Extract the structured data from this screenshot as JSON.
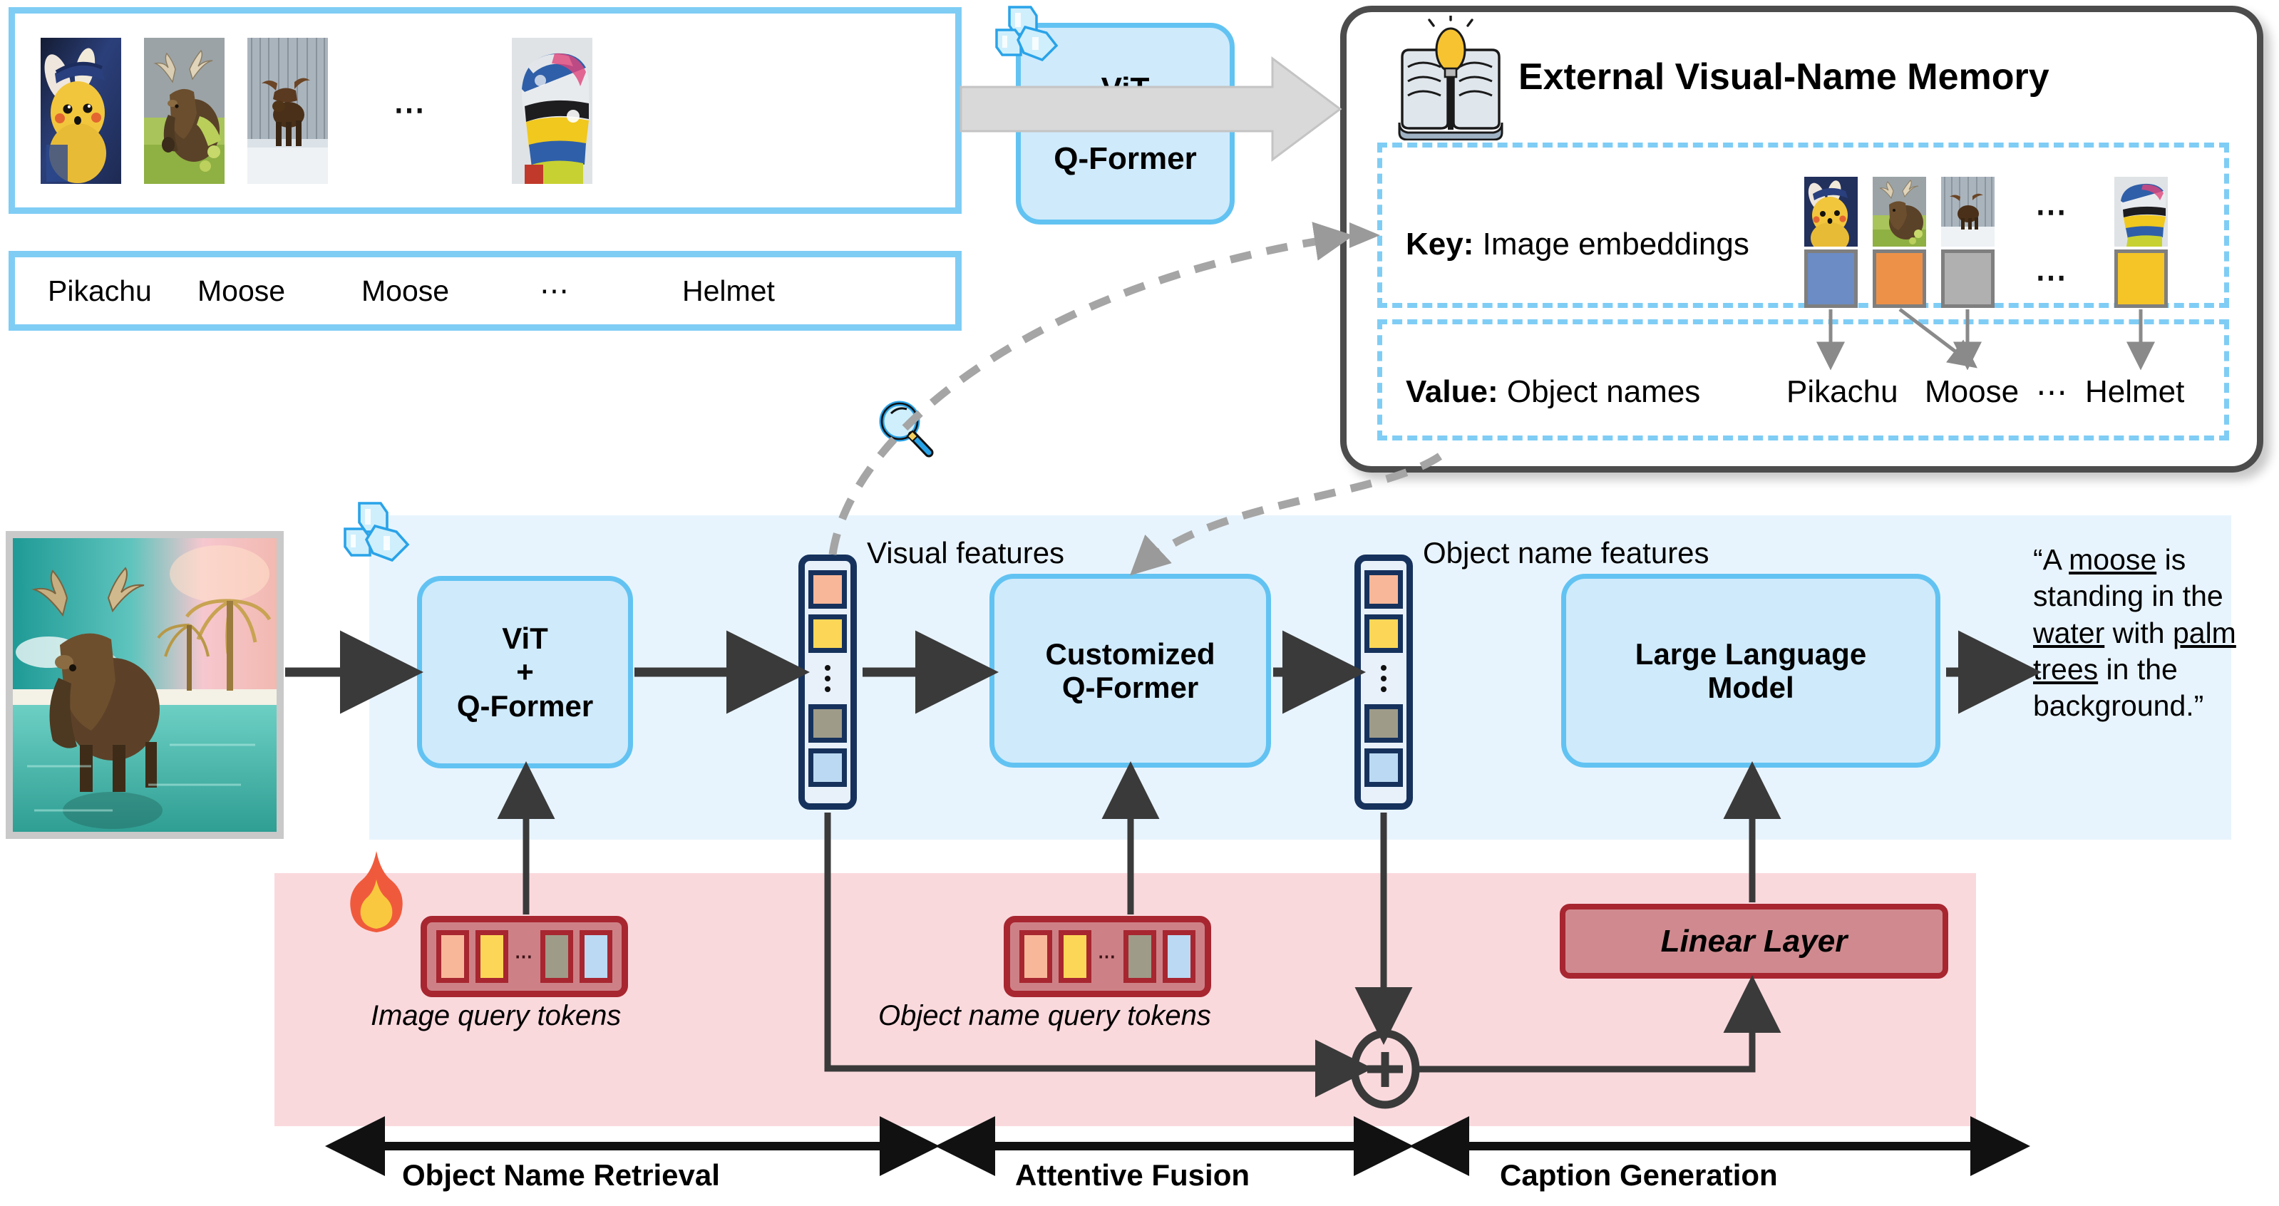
{
  "figure": {
    "title": "Object Name Retrieval, Attentive Fusion and Caption Generation pipeline"
  },
  "gallery": {
    "thumbnails": [
      {
        "name": "Pikachu",
        "alt": "pikachu-thumbnail"
      },
      {
        "name": "Moose",
        "alt": "moose-grass-thumbnail"
      },
      {
        "name": "Moose",
        "alt": "moose-snow-thumbnail"
      },
      {
        "name": "Helmet",
        "alt": "racing-helmet-thumbnail"
      }
    ],
    "ellipsis": "⋯",
    "names": [
      "Pikachu",
      "Moose",
      "Moose",
      "⋯",
      "Helmet"
    ]
  },
  "encoder_top": {
    "line1": "ViT",
    "line2": "+",
    "line3": "Q-Former",
    "frozen_icon": "ice-cubes-icon"
  },
  "memory": {
    "title": "External Visual-Name Memory",
    "book_icon": "book-lightbulb-icon",
    "key_row": {
      "label_bold": "Key:",
      "label_rest": " Image embeddings",
      "embeddings": [
        {
          "color": "#6b8cc4",
          "name": "pikachu-embedding"
        },
        {
          "color": "#ed9149",
          "name": "moose-grass-embedding"
        },
        {
          "color": "#b0b0b0",
          "name": "moose-snow-embedding"
        },
        {
          "color": "#f5c426",
          "name": "helmet-embedding"
        }
      ],
      "ellipsis": "⋯"
    },
    "value_row": {
      "label_bold": "Value:",
      "label_rest": " Object names",
      "names": [
        "Pikachu",
        "Moose",
        "⋯",
        "Helmet"
      ]
    }
  },
  "pipeline": {
    "input_image_alt": "moose-standing-in-water-photo",
    "frozen_icon": "ice-cubes-icon",
    "trainable_icon": "flame-icon",
    "retrieval_icon": "magnifier-icon",
    "vit_qformer": {
      "line1": "ViT",
      "line2": "+",
      "line3": "Q-Former"
    },
    "customized_qformer": {
      "line1": "Customized",
      "line2": "Q-Former"
    },
    "llm": {
      "line1": "Large Language",
      "line2": "Model"
    },
    "visual_features_label": "Visual features",
    "object_name_features_label": "Object name features",
    "image_query_tokens_label": "Image query tokens",
    "object_name_query_tokens_label": "Object name query tokens",
    "linear_layer_label": "Linear Layer",
    "sum_symbol": "+",
    "token_colors": [
      "#f9b799",
      "#fcd757",
      "#9e9b88",
      "#bbd9f2"
    ],
    "token_ellipsis": "⋯"
  },
  "caption": {
    "full_text": "“A moose is standing in the water with palm trees in the background.”",
    "segments": [
      {
        "text": "“A ",
        "underline": false
      },
      {
        "text": "moose",
        "underline": true
      },
      {
        "text": " is standing in the ",
        "underline": false
      },
      {
        "text": "water",
        "underline": true
      },
      {
        "text": " with ",
        "underline": false
      },
      {
        "text": "palm trees",
        "underline": true
      },
      {
        "text": " in the background.”",
        "underline": false
      }
    ]
  },
  "stages": [
    {
      "label": "Object Name Retrieval"
    },
    {
      "label": "Attentive Fusion"
    },
    {
      "label": "Caption Generation"
    }
  ],
  "colors": {
    "accent_blue": "#7fcdf5",
    "band_blue": "#e8f4fd",
    "band_pink": "#fad9dd",
    "module_fill": "#cfeafb",
    "module_border": "#62c3f2",
    "token_border": "#16325c",
    "trainable_red": "#a72630",
    "trainable_fill": "#cd8186",
    "arrow_dark": "#3a3a3a",
    "arrow_gray": "#8a8a8a"
  }
}
